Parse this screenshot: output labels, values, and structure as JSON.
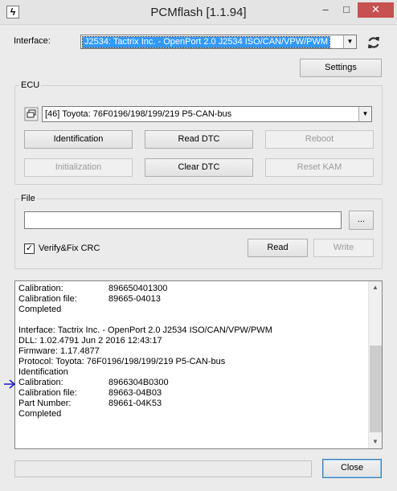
{
  "window": {
    "title": "PCMflash [1.1.94]",
    "app_icon_glyph": "ϟ",
    "min_glyph": "–",
    "max_glyph": "□",
    "close_glyph": "✕"
  },
  "interface": {
    "label": "Interface:",
    "selected": "J2534: Tactrix Inc. - OpenPort 2.0 J2534 ISO/CAN/VPW/PWM",
    "refresh_icon": "refresh-icon",
    "settings_label": "Settings"
  },
  "ecu": {
    "group_label": "ECU",
    "selected": "[46] Toyota: 76F0196/198/199/219 P5-CAN-bus",
    "buttons": {
      "identification": "Identification",
      "read_dtc": "Read DTC",
      "reboot": "Reboot",
      "initialization": "Initialization",
      "clear_dtc": "Clear DTC",
      "reset_kam": "Reset KAM"
    }
  },
  "file": {
    "group_label": "File",
    "path_value": "",
    "browse_label": "...",
    "verify_label": "Verify&Fix CRC",
    "verify_checked": true,
    "read_label": "Read",
    "write_label": "Write"
  },
  "log": {
    "lines": [
      {
        "k": "Calibration:",
        "v": "896650401300"
      },
      {
        "k": "Calibration file:",
        "v": "89665-04013"
      },
      {
        "k": "Completed",
        "v": ""
      },
      {
        "k": "",
        "v": ""
      },
      {
        "k": "Interface: Tactrix Inc. - OpenPort 2.0 J2534 ISO/CAN/VPW/PWM",
        "v": ""
      },
      {
        "k": "DLL: 1.02.4791 Jun  2 2016 12:43:17",
        "v": ""
      },
      {
        "k": "Firmware: 1.17.4877",
        "v": ""
      },
      {
        "k": "Protocol: Toyota: 76F0196/198/199/219 P5-CAN-bus",
        "v": ""
      },
      {
        "k": "Identification",
        "v": ""
      },
      {
        "k": "Calibration:",
        "v": "8966304B0300"
      },
      {
        "k": "Calibration file:",
        "v": "89663-04B03"
      },
      {
        "k": "Part Number:",
        "v": "89661-04K53"
      },
      {
        "k": "Completed",
        "v": ""
      }
    ],
    "marker_color": "#1a1acc"
  },
  "status_text": "",
  "close_label": "Close"
}
